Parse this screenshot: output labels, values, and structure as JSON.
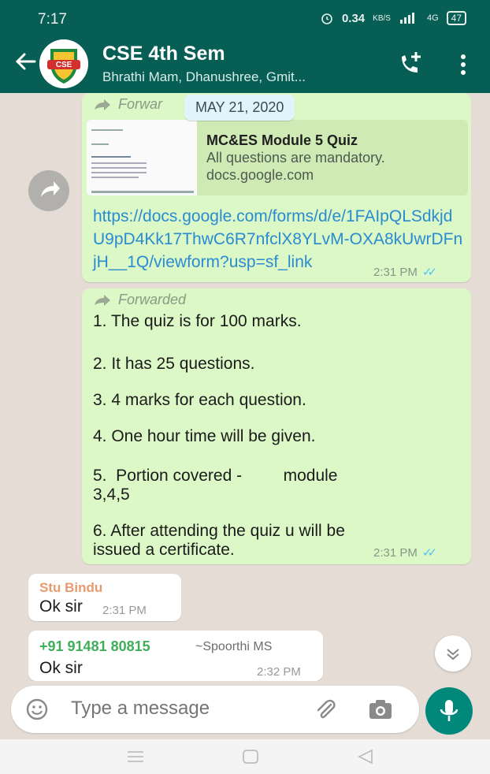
{
  "status_bar": {
    "time": "7:17",
    "net_speed": "0.34",
    "net_unit": "KB/S",
    "network": "4G",
    "battery": "47"
  },
  "header": {
    "avatar_text": "CSE",
    "title": "CSE 4th Sem",
    "subtitle": "Bhrathi Mam, Dhanushree, Gmit..."
  },
  "messages": {
    "date_chip": "MAY 21, 2020",
    "forwarded_label": "Forwarded",
    "forwarded_label_short": "Forwar",
    "link_preview": {
      "title": "MC&ES Module 5 Quiz",
      "description": "All questions are mandatory.",
      "site": "docs.google.com"
    },
    "link_text": "https://docs.google.com/forms/d/e/1FAIpQLSdkjdU9pD4Kk17ThwC6R7nfclX8YLvM-OXA8kUwrDFnjH__1Q/viewform?usp=sf_link",
    "link_time": "2:31 PM",
    "quiz_lines": [
      "1. The quiz is for 100 marks.",
      "2. It has 25 questions.",
      "3. 4 marks for each question.",
      "4. One hour time will be given.",
      "5.  Portion covered -         module",
      "3,4,5",
      "6. After attending the quiz u will be",
      "issued a certificate."
    ],
    "quiz_time": "2:31 PM",
    "reply1": {
      "sender": "Stu Bindu",
      "text": "Ok sir",
      "time": "2:31 PM"
    },
    "reply2": {
      "sender": "+91 91481 80815",
      "sender_name": "~Spoorthi MS",
      "text": "Ok sir",
      "time": "2:32 PM"
    }
  },
  "input": {
    "placeholder": "Type a message"
  },
  "colors": {
    "header": "#075e54",
    "bubble_out": "#dcf8c6",
    "mic": "#00897b",
    "link": "#2a8bd2"
  }
}
